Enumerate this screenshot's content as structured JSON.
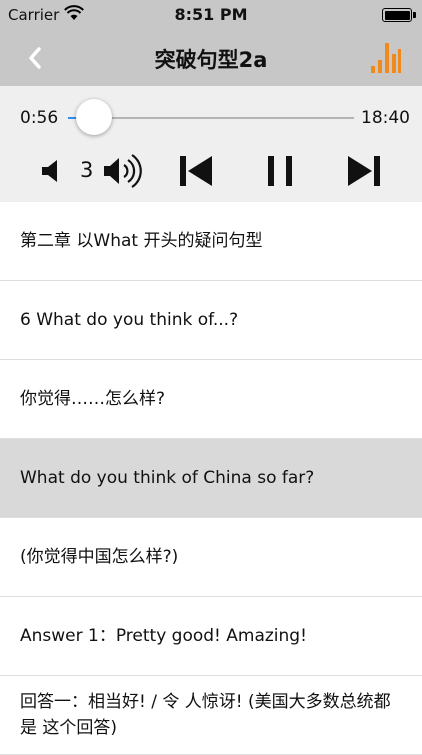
{
  "status_bar": {
    "carrier": "Carrier",
    "time": "8:51 PM"
  },
  "nav": {
    "title": "突破句型2a",
    "back_icon": "chevron-left-icon",
    "chart_icon": "equalizer-icon",
    "accent": "#f08a1c"
  },
  "player": {
    "current_time": "0:56",
    "total_time": "18:40",
    "progress": 0.05,
    "volume": "3",
    "accent": "#2f8cf0"
  },
  "list": {
    "items": [
      {
        "text": "第二章 以What 开头的疑问句型",
        "selected": false
      },
      {
        "text": "6 What do you think of...?",
        "selected": false
      },
      {
        "text": "你觉得……怎么样?",
        "selected": false
      },
      {
        "text": "What do you think of China so far?",
        "selected": true
      },
      {
        "text": "(你觉得中国怎么样?)",
        "selected": false
      },
      {
        "text": "Answer 1：Pretty good! Amazing!",
        "selected": false
      },
      {
        "text": "回答一：相当好! / 令 人惊讶! (美国大多数总统都是 这个回答)",
        "selected": false
      }
    ]
  }
}
